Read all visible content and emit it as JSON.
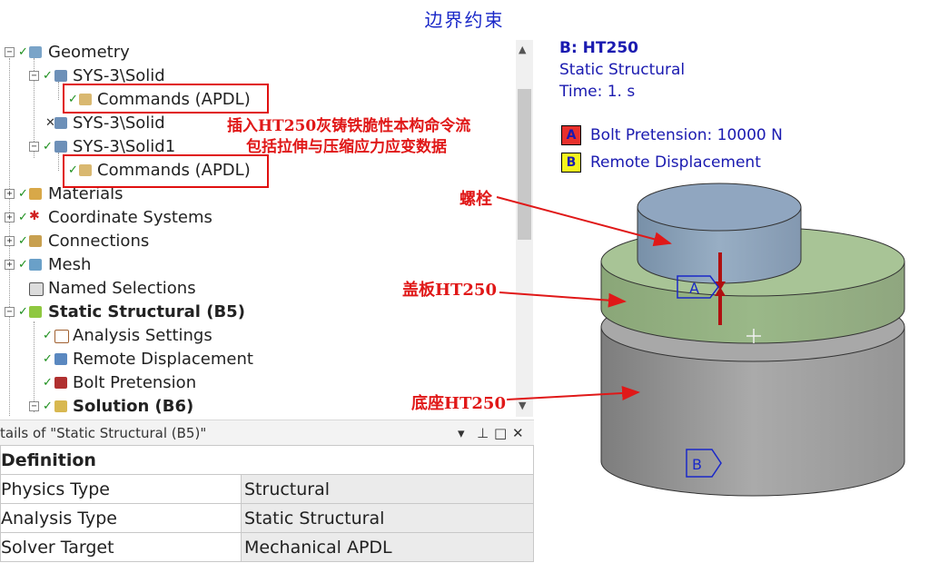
{
  "page_title": "边界约束",
  "tree": {
    "items": [
      {
        "label": "Geometry",
        "icon": "geometry-icon"
      },
      {
        "label": "SYS-3\\Solid",
        "icon": "solid-body-icon"
      },
      {
        "label": "Commands (APDL)",
        "icon": "commands-icon"
      },
      {
        "label": "SYS-3\\Solid",
        "icon": "solid-body-icon"
      },
      {
        "label": "SYS-3\\Solid1",
        "icon": "solid-body-icon"
      },
      {
        "label": "Commands (APDL)",
        "icon": "commands-icon"
      },
      {
        "label": "Materials",
        "icon": "materials-icon"
      },
      {
        "label": "Coordinate Systems",
        "icon": "coordinate-systems-icon"
      },
      {
        "label": "Connections",
        "icon": "connections-icon"
      },
      {
        "label": "Mesh",
        "icon": "mesh-icon"
      },
      {
        "label": "Named Selections",
        "icon": "named-selections-icon"
      },
      {
        "label": "Static Structural (B5)",
        "icon": "static-structural-icon"
      },
      {
        "label": "Analysis Settings",
        "icon": "analysis-settings-icon"
      },
      {
        "label": "Remote Displacement",
        "icon": "remote-displacement-icon"
      },
      {
        "label": "Bolt Pretension",
        "icon": "bolt-pretension-icon"
      },
      {
        "label": "Solution (B6)",
        "icon": "solution-icon"
      }
    ],
    "annotation_line1": "插入HT250灰铸铁脆性本构命令流",
    "annotation_line2": "包括拉伸与压缩应力应变数据"
  },
  "details": {
    "title": "tails of \"Static Structural (B5)\"",
    "controls": [
      "▾",
      "⊥",
      "□",
      "✕"
    ],
    "section": "Definition",
    "rows": [
      {
        "name": "Physics Type",
        "value": "Structural"
      },
      {
        "name": "Analysis Type",
        "value": "Static Structural"
      },
      {
        "name": "Solver Target",
        "value": "Mechanical APDL"
      }
    ]
  },
  "graphics": {
    "title": "B: HT250",
    "analysis": "Static Structural",
    "time": "Time: 1. s",
    "legend": [
      {
        "key": "A",
        "label": "Bolt Pretension: 10000 N",
        "color": "#e8302c"
      },
      {
        "key": "B",
        "label": "Remote Displacement",
        "color": "#f4f41c"
      }
    ],
    "annotations": {
      "bolt": "螺栓",
      "cover": "盖板HT250",
      "base": "底座HT250"
    },
    "markers": {
      "a": "A",
      "b": "B"
    }
  },
  "colors": {
    "title_blue": "#1a28c8",
    "annotation_red": "#e01818",
    "check_green": "#1d8f1d"
  }
}
